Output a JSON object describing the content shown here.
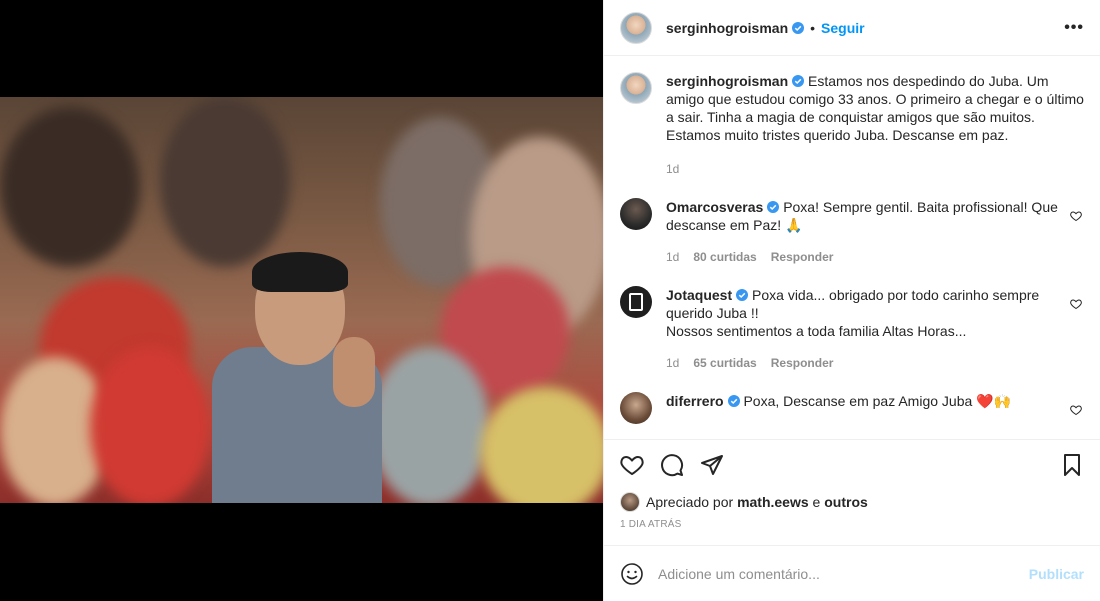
{
  "post": {
    "author": "serginhogroisman",
    "follow_label": "Seguir",
    "dot": "•",
    "more_label": "•••",
    "caption_author": "serginhogroisman",
    "caption": "Estamos nos despedindo do Juba. Um amigo que estudou comigo 33 anos. O primeiro a chegar e o último a sair. Tinha a magia de conquistar amigos que são muitos. Estamos muito tristes querido Juba. Descanse em paz.",
    "caption_time": "1d"
  },
  "comments": [
    {
      "user": "Omarcosveras",
      "text": "Poxa! Sempre gentil. Baita profissional! Que descanse em Paz! 🙏",
      "time": "1d",
      "likes": "80 curtidas",
      "reply": "Responder"
    },
    {
      "user": "Jotaquest",
      "text": "Poxa vida... obrigado por todo carinho sempre querido Juba !!",
      "text2": "Nossos sentimentos a toda familia Altas Horas...",
      "time": "1d",
      "likes": "65 curtidas",
      "reply": "Responder"
    },
    {
      "user": "diferrero",
      "text": "Poxa, Descanse em paz Amigo Juba ❤️🙌"
    }
  ],
  "likes_line": {
    "prefix": "Apreciado por",
    "user": "math.eews",
    "suffix": "e",
    "others": "outros"
  },
  "time_ago": "1 DIA ATRÁS",
  "add_comment": {
    "placeholder": "Adicione um comentário...",
    "publish": "Publicar"
  },
  "colors": {
    "accent": "#0095f6",
    "publish_disabled": "#b2dffc",
    "verified": "#3897f0"
  }
}
